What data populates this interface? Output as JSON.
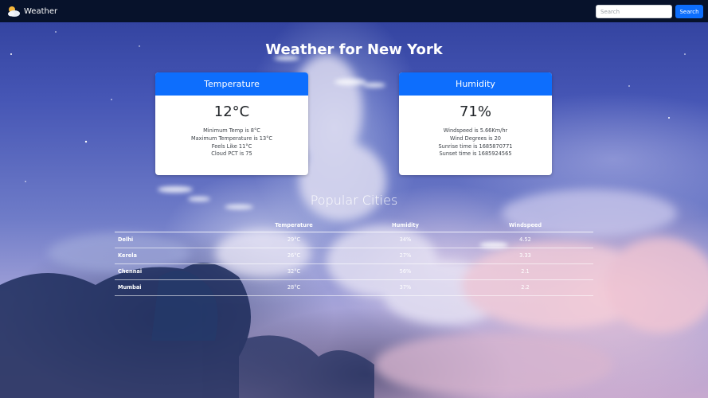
{
  "navbar": {
    "brand_icon": "cloud-sun-icon",
    "brand_text": "Weather",
    "search_placeholder": "Search",
    "search_button": "Search"
  },
  "page_title": "Weather for New York",
  "temperature_card": {
    "header": "Temperature",
    "value": "12°C",
    "lines": [
      "Minimum Temp is 8°C",
      "Maximum Temperature is 13°C",
      "Feels Like 11°C",
      "Cloud PCT is 75"
    ]
  },
  "humidity_card": {
    "header": "Humidity",
    "value": "71%",
    "lines": [
      "Windspeed is 5.66Km/hr",
      "Wind Degrees is 20",
      "Sunrise time is 1685870771",
      "Sunset time is 1685924565"
    ]
  },
  "popular_cities": {
    "title": "Popular Cities",
    "columns": [
      "",
      "Temperature",
      "Humidity",
      "Windspeed"
    ],
    "rows": [
      {
        "city": "Delhi",
        "temperature": "29°C",
        "humidity": "34%",
        "windspeed": "4.52"
      },
      {
        "city": "Kerela",
        "temperature": "26°C",
        "humidity": "27%",
        "windspeed": "3.33"
      },
      {
        "city": "Chennai",
        "temperature": "32°C",
        "humidity": "56%",
        "windspeed": "2.1"
      },
      {
        "city": "Mumbai",
        "temperature": "28°C",
        "humidity": "37%",
        "windspeed": "2.2"
      }
    ]
  },
  "colors": {
    "navbar_bg": "#07122b",
    "accent": "#0d6efd",
    "card_bg": "#ffffff"
  }
}
